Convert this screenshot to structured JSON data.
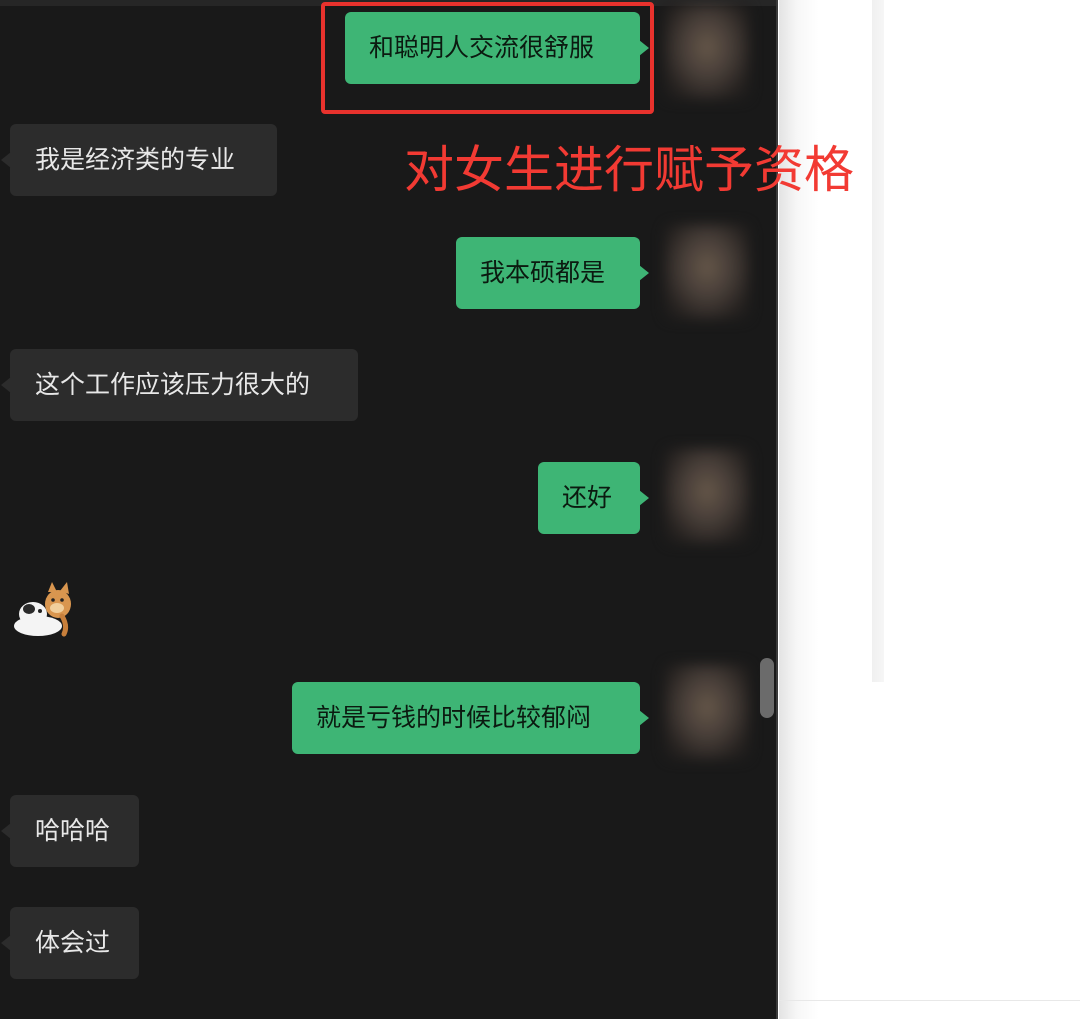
{
  "messages": [
    {
      "side": "sent",
      "text": "和聪明人交流很舒服"
    },
    {
      "side": "recv",
      "text": "我是经济类的专业"
    },
    {
      "side": "sent",
      "text": "我本硕都是"
    },
    {
      "side": "recv",
      "text": "这个工作应该压力很大的"
    },
    {
      "side": "sent",
      "text": "还好"
    },
    {
      "side": "recv",
      "sticker": "cat-dog-hug-sticker"
    },
    {
      "side": "sent",
      "text": "就是亏钱的时候比较郁闷"
    },
    {
      "side": "recv",
      "text": "哈哈哈"
    },
    {
      "side": "recv",
      "text": "体会过"
    }
  ],
  "annotation": {
    "text": "对女生进行赋予资格",
    "color": "#f23a33"
  },
  "colors": {
    "chat_background": "#191919",
    "sent_bubble": "#3eb575",
    "received_bubble": "#2c2c2c",
    "highlight_border": "#e8322d"
  }
}
